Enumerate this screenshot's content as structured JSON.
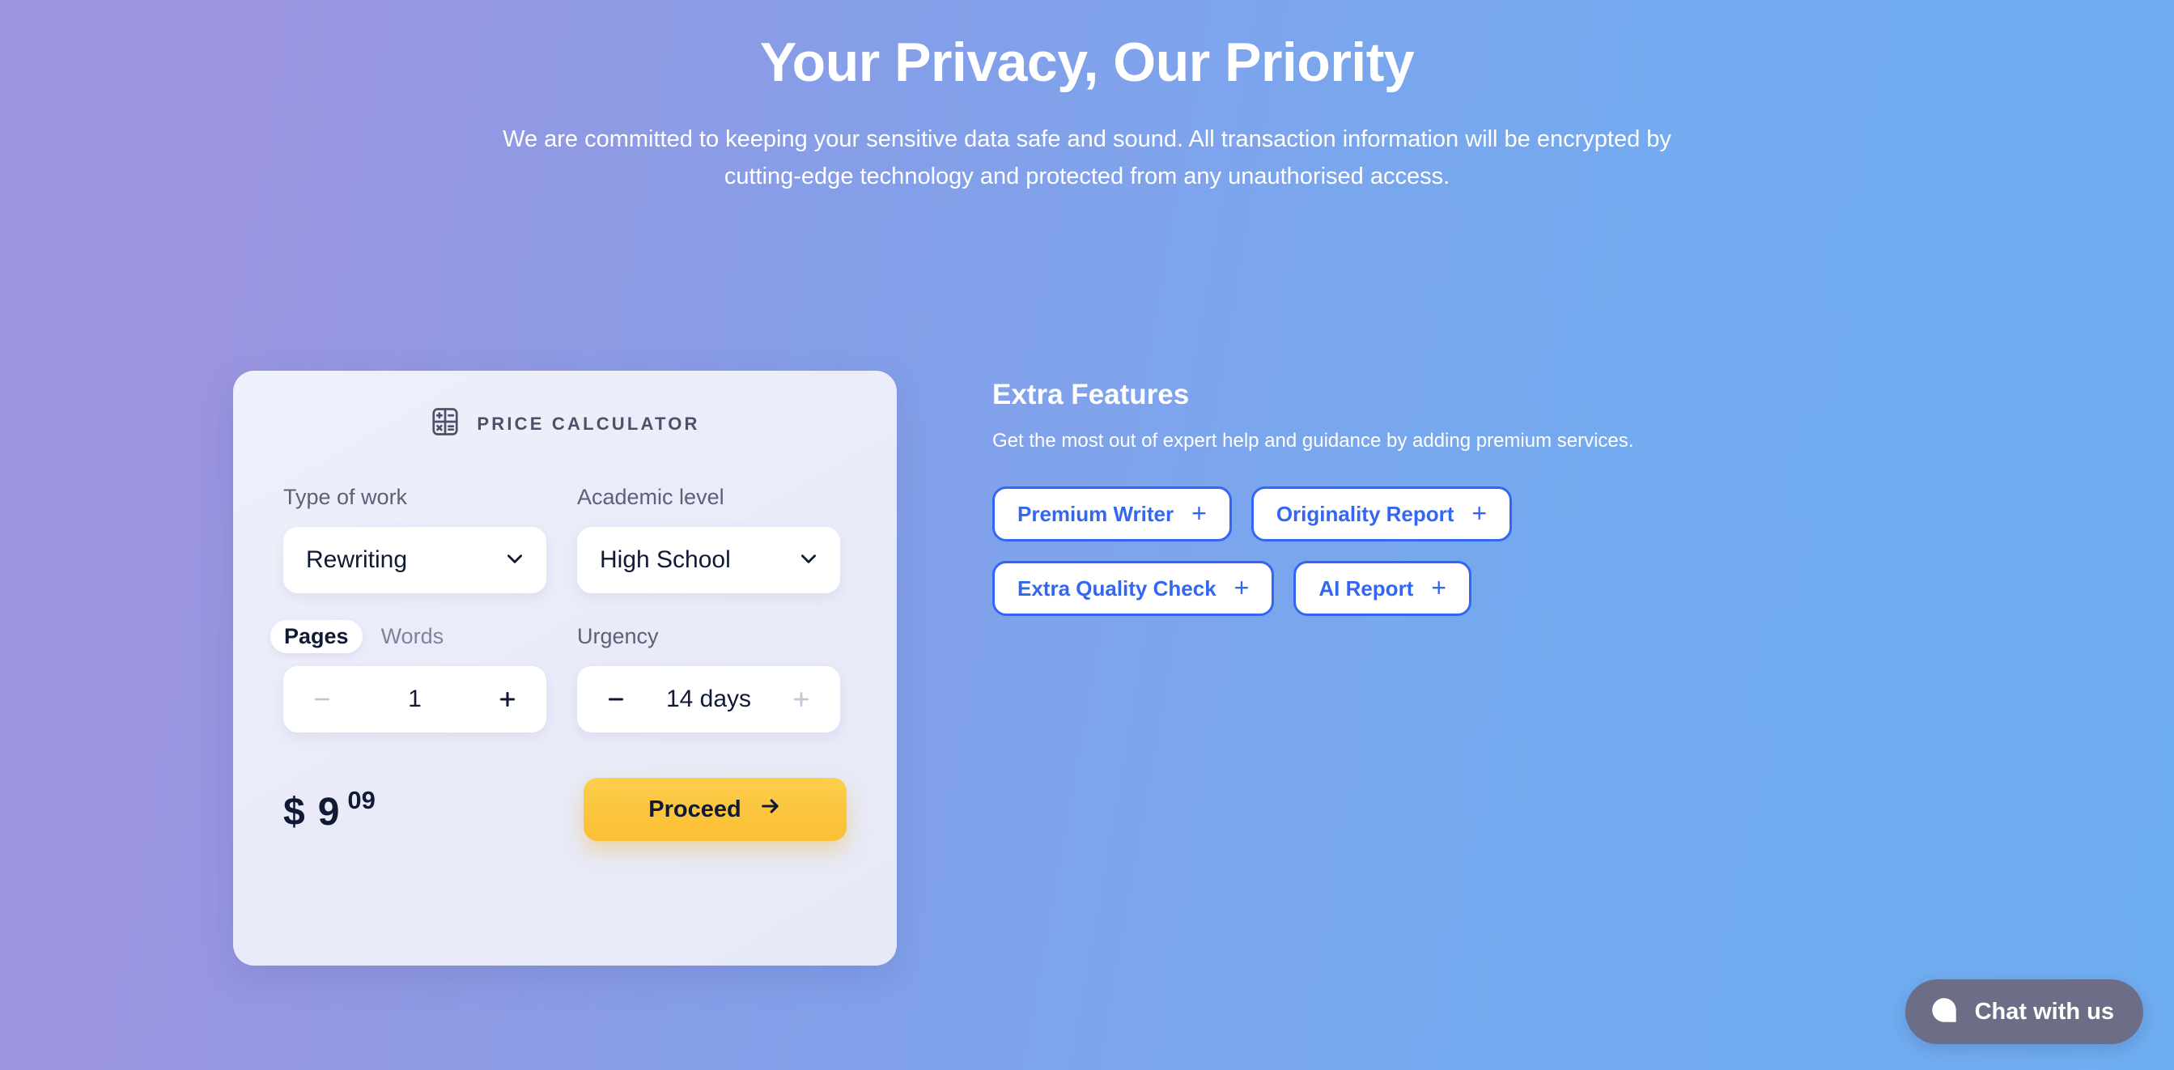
{
  "hero": {
    "title": "Your Privacy, Our Priority",
    "subtitle": "We are committed to keeping your sensitive data safe and sound. All transaction information will be encrypted by cutting-edge technology and protected from any unauthorised access."
  },
  "calculator": {
    "heading": "PRICE CALCULATOR",
    "icon": "calculator-icon",
    "type_of_work": {
      "label": "Type of work",
      "value": "Rewriting"
    },
    "academic_level": {
      "label": "Academic level",
      "value": "High School"
    },
    "amount": {
      "options": [
        "Pages",
        "Words"
      ],
      "selected": "Pages",
      "value": "1",
      "decrement_label": "–",
      "increment_label": "+",
      "decrement_enabled": false,
      "increment_enabled": true
    },
    "urgency": {
      "label": "Urgency",
      "value": "14 days",
      "decrement_label": "–",
      "increment_label": "+",
      "decrement_enabled": true,
      "increment_enabled": false
    },
    "price": {
      "currency": "$",
      "integer": "9",
      "decimal": "09"
    },
    "proceed_label": "Proceed"
  },
  "extras": {
    "title": "Extra Features",
    "subtitle": "Get the most out of expert help and guidance by adding premium services.",
    "chips": [
      {
        "label": "Premium Writer",
        "add": "+"
      },
      {
        "label": "Originality Report",
        "add": "+"
      },
      {
        "label": "Extra Quality Check",
        "add": "+"
      },
      {
        "label": "AI Report",
        "add": "+"
      }
    ]
  },
  "chat": {
    "label": "Chat with us",
    "icon": "chat-bubble-icon"
  },
  "colors": {
    "background_start": "#9d95df",
    "background_end": "#6fadf1",
    "accent_blue": "#3366f2",
    "accent_yellow": "#fbc53d",
    "text_dark": "#111a34",
    "card_background": "#eaecf9",
    "chat_background": "#6b6e86"
  }
}
